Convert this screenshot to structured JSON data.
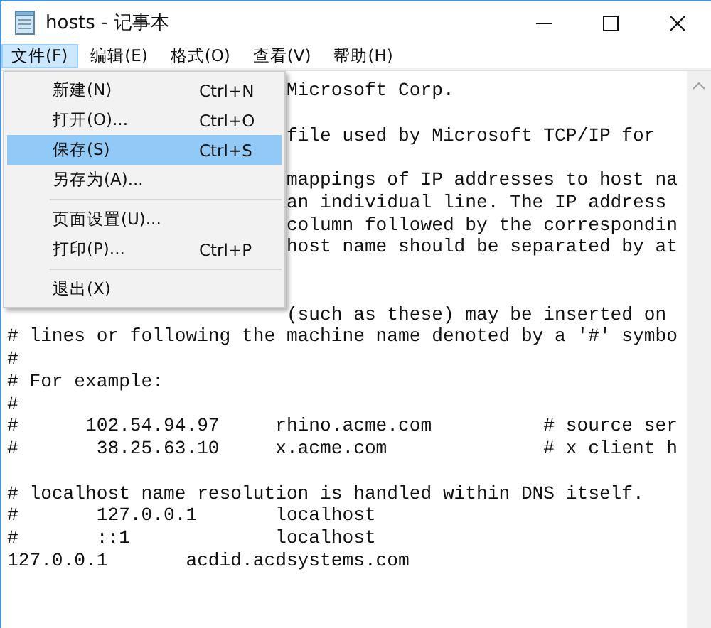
{
  "window": {
    "title": "hosts - 记事本"
  },
  "menu_bar": [
    {
      "label": "文件(F)",
      "selected": true
    },
    {
      "label": "编辑(E)",
      "selected": false
    },
    {
      "label": "格式(O)",
      "selected": false
    },
    {
      "label": "查看(V)",
      "selected": false
    },
    {
      "label": "帮助(H)",
      "selected": false
    }
  ],
  "dropdown_menu": [
    {
      "kind": "item",
      "label": "新建(N)",
      "shortcut": "Ctrl+N",
      "selected": false
    },
    {
      "kind": "item",
      "label": "打开(O)...",
      "shortcut": "Ctrl+O",
      "selected": false
    },
    {
      "kind": "item",
      "label": "保存(S)",
      "shortcut": "Ctrl+S",
      "selected": true
    },
    {
      "kind": "item",
      "label": "另存为(A)...",
      "selected": false
    },
    {
      "kind": "separator"
    },
    {
      "kind": "item",
      "label": "页面设置(U)...",
      "selected": false
    },
    {
      "kind": "item",
      "label": "打印(P)...",
      "shortcut": "Ctrl+P",
      "selected": false
    },
    {
      "kind": "separator"
    },
    {
      "kind": "item",
      "label": "退出(X)",
      "selected": false
    }
  ],
  "editor": {
    "lines": [
      {
        "kind": "behind_menu",
        "text": "Microsoft Corp."
      },
      {
        "kind": "blank"
      },
      {
        "kind": "behind_menu",
        "text": "file used by Microsoft TCP/IP for"
      },
      {
        "kind": "blank"
      },
      {
        "kind": "behind_menu",
        "text": "mappings of IP addresses to host na"
      },
      {
        "kind": "behind_menu",
        "text": "an individual line. The IP address"
      },
      {
        "kind": "behind_menu",
        "text": "column followed by the correspondin"
      },
      {
        "kind": "behind_menu",
        "text": "host name should be separated by at"
      },
      {
        "kind": "blank"
      },
      {
        "kind": "blank"
      },
      {
        "kind": "behind_menu",
        "text": "(such as these) may be inserted on"
      },
      {
        "kind": "text",
        "text": "# lines or following the machine name denoted by a '#' symbo"
      },
      {
        "kind": "text",
        "text": "#"
      },
      {
        "kind": "text",
        "text": "# For example:"
      },
      {
        "kind": "text",
        "text": "#"
      },
      {
        "kind": "text",
        "text": "#      102.54.94.97     rhino.acme.com          # source ser"
      },
      {
        "kind": "text",
        "text": "#       38.25.63.10     x.acme.com              # x client h"
      },
      {
        "kind": "blank"
      },
      {
        "kind": "text",
        "text": "# localhost name resolution is handled within DNS itself."
      },
      {
        "kind": "text",
        "text": "#       127.0.0.1       localhost"
      },
      {
        "kind": "text",
        "text": "#       ::1             localhost"
      },
      {
        "kind": "text",
        "text": "127.0.0.1       acdid.acdsystems.com"
      }
    ]
  }
}
